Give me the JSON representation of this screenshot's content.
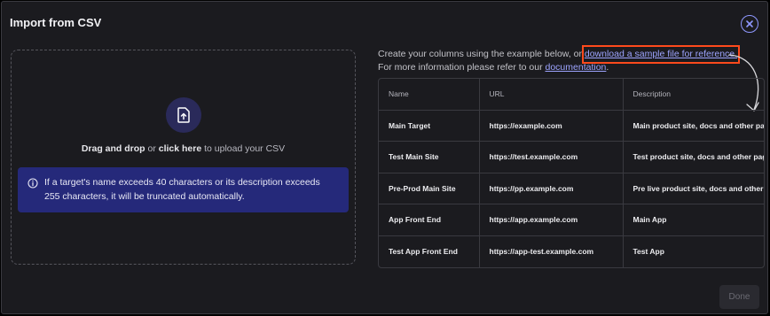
{
  "modal": {
    "title": "Import from CSV",
    "close_icon": "close-icon"
  },
  "dropzone": {
    "upload_icon": "file-upload-icon",
    "prefix": "Drag and drop",
    "middle": " or ",
    "link": "click here",
    "suffix": " to upload your CSV",
    "info_icon": "info-icon",
    "info": "If a target's name exceeds 40 characters or its description exceeds 255 characters, it will be truncated automatically."
  },
  "instructions": {
    "line1_prefix": "Create your columns using the example below, or ",
    "sample_link": "download a sample file for reference.",
    "line2_prefix": "For more information please refer to our ",
    "doc_link": "documentation",
    "line2_suffix": "."
  },
  "table": {
    "headers": [
      "Name",
      "URL",
      "Description"
    ],
    "rows": [
      [
        "Main Target",
        "https://example.com",
        "Main product site, docs and other pag"
      ],
      [
        "Test Main Site",
        "https://test.example.com",
        "Test product site, docs and other pag"
      ],
      [
        "Pre-Prod Main Site",
        "https://pp.example.com",
        "Pre live product site, docs and other p"
      ],
      [
        "App Front End",
        "https://app.example.com",
        "Main App"
      ],
      [
        "Test App Front End",
        "https://app-test.example.com",
        "Test App"
      ]
    ]
  },
  "annotation": {
    "arrow_icon": "curved-arrow-icon",
    "highlight_color": "#ff4a1c"
  },
  "footer": {
    "done_label": "Done"
  }
}
